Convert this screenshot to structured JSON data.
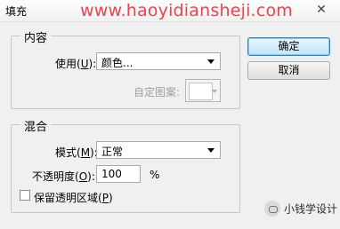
{
  "window": {
    "title": "填充",
    "watermark": "www.haoyidiansheji.com",
    "close_glyph": "✕"
  },
  "content_group": {
    "legend": "内容",
    "use_label": "使用(",
    "use_key": "U",
    "label_close": "):",
    "use_value": "颜色...",
    "custom_pattern_label": "自定图案:"
  },
  "blend_group": {
    "legend": "混合",
    "mode_label": "模式(",
    "mode_key": "M",
    "label_close": "):",
    "mode_value": "正常",
    "opacity_label": "不透明度(",
    "opacity_key": "O",
    "opacity_value": "100",
    "opacity_unit": "%",
    "preserve_label": "保留透明区域(",
    "preserve_key": "P",
    "preserve_close": ")",
    "preserve_checked": false
  },
  "buttons": {
    "ok": "确定",
    "cancel": "取消"
  },
  "logo": {
    "text": "小钱学设计"
  }
}
